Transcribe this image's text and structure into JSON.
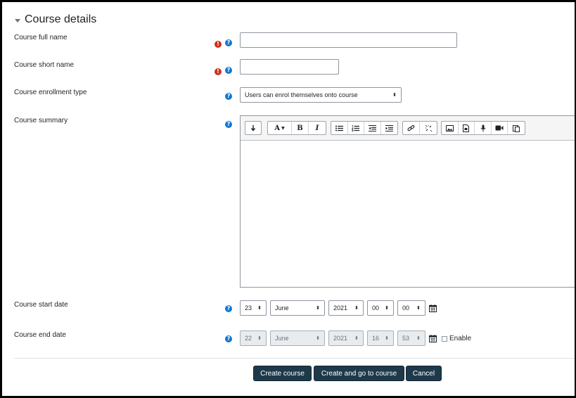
{
  "section": {
    "title": "Course details"
  },
  "fields": {
    "full_name": {
      "label": "Course full name",
      "value": ""
    },
    "short_name": {
      "label": "Course short name",
      "value": ""
    },
    "enrollment": {
      "label": "Course enrollment type",
      "selected": "Users can enrol themselves onto course"
    },
    "summary": {
      "label": "Course summary"
    },
    "start_date": {
      "label": "Course start date",
      "day": "23",
      "month": "June",
      "year": "2021",
      "hour": "00",
      "minute": "00"
    },
    "end_date": {
      "label": "Course end date",
      "day": "22",
      "month": "June",
      "year": "2021",
      "hour": "16",
      "minute": "53",
      "enable_label": "Enable"
    }
  },
  "toolbar": {
    "font_label": "A",
    "bold_label": "B",
    "italic_label": "I"
  },
  "icons": {
    "required": "exclamation-icon",
    "help": "question-icon"
  },
  "glyphs": {
    "required": "!",
    "help": "?",
    "select_arrows": "⬍"
  },
  "buttons": {
    "create": "Create course",
    "create_go": "Create and go to course",
    "cancel": "Cancel"
  },
  "colors": {
    "required": "#ca3120",
    "help": "#1177d1",
    "button": "#1e3a4a"
  }
}
